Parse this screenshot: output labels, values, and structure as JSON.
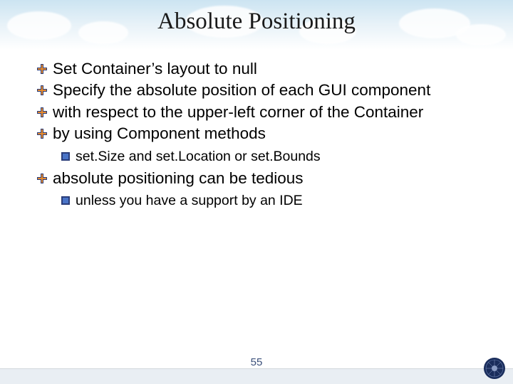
{
  "title": "Absolute Positioning",
  "bullets": [
    {
      "level": 1,
      "text": "Set Container’s layout to null"
    },
    {
      "level": 1,
      "text": "Specify the absolute position of each GUI component"
    },
    {
      "level": 1,
      "text": "with respect to the upper-left corner of the Container"
    },
    {
      "level": 1,
      "text": "by using Component methods"
    },
    {
      "level": 2,
      "text": "set.Size and set.Location or set.Bounds"
    },
    {
      "level": 1,
      "text": "absolute positioning can be tedious"
    },
    {
      "level": 2,
      "text": "unless you have a support by an IDE"
    }
  ],
  "page_number": "55",
  "icons": {
    "level1_name": "orange-cross-bullet-icon",
    "level2_name": "blue-square-bullet-icon"
  },
  "colors": {
    "bullet1_outer": "#2a3d7a",
    "bullet1_inner": "#e68a2e",
    "bullet2_outer": "#2a3d7a",
    "bullet2_inner": "#4a74c7",
    "page_num": "#3a4f7a"
  }
}
